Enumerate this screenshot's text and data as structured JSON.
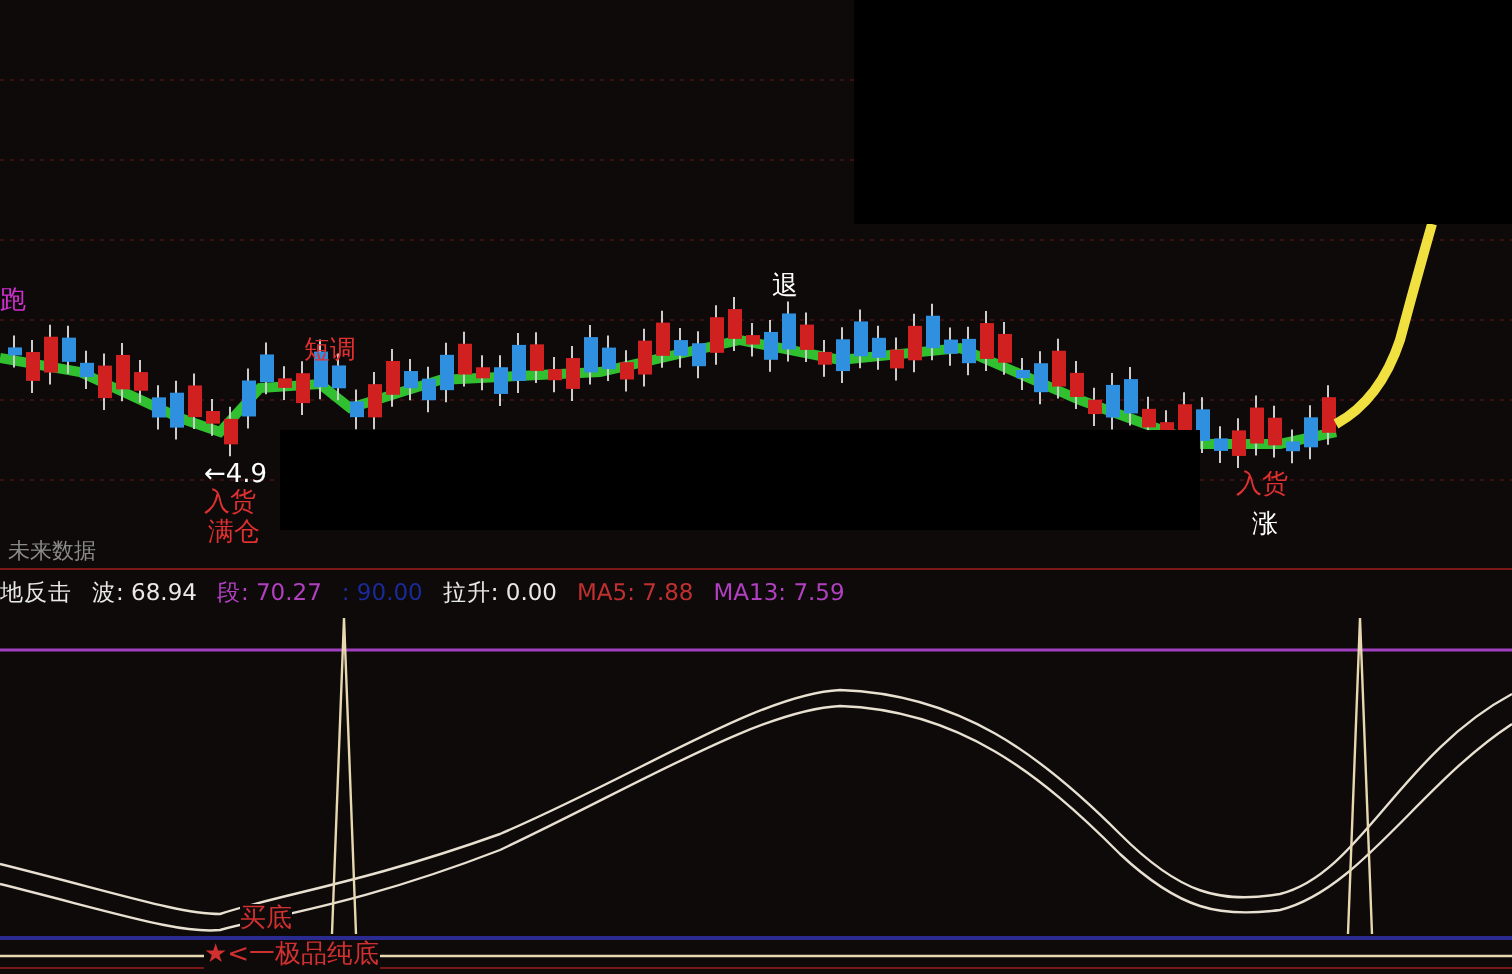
{
  "main_chart": {
    "labels": [
      {
        "text": "跑",
        "color": "#d030d0"
      },
      {
        "text": "短调",
        "color": "#e03030"
      },
      {
        "text": "退",
        "color": "#ffffff"
      },
      {
        "text": "←4.9",
        "color": "#ffffff"
      },
      {
        "text": "入货",
        "color": "#e03030"
      },
      {
        "text": "满仓",
        "color": "#e03030"
      },
      {
        "text": "入货",
        "color": "#e03030"
      },
      {
        "text": "涨",
        "color": "#ffffff"
      }
    ],
    "note": "未来数据"
  },
  "indicator": {
    "title": "地反击",
    "values": [
      {
        "text": "波: 68.94",
        "color": "#e8e8e8"
      },
      {
        "text": "段: 70.27",
        "color": "#b040c0"
      },
      {
        "text": ": 90.00",
        "color": "#1a2a9a"
      },
      {
        "text": "拉升: 0.00",
        "color": "#e8e8e8"
      },
      {
        "text": "MA5: 7.88",
        "color": "#c03030"
      },
      {
        "text": "MA13: 7.59",
        "color": "#b040c0"
      }
    ],
    "labels": [
      {
        "text": "买底",
        "color": "#d03030"
      },
      {
        "text": "★<一极品纯底",
        "color": "#d03030"
      }
    ]
  }
}
